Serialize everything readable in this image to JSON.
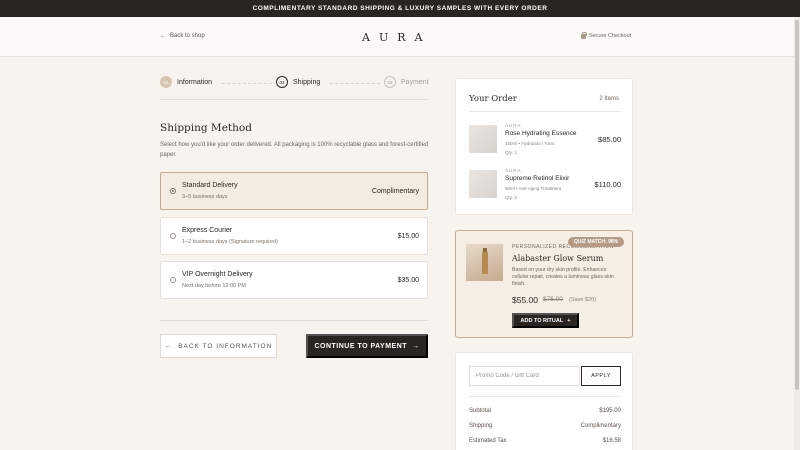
{
  "banner": {
    "text": "COMPLIMENTARY STANDARD SHIPPING & LUXURY SAMPLES WITH EVERY ORDER"
  },
  "header": {
    "back_label": "Back to shop",
    "logo": "AURA",
    "secure_label": "Secure Checkout"
  },
  "steps": [
    {
      "num": "01",
      "label": "Information"
    },
    {
      "num": "02",
      "label": "Shipping"
    },
    {
      "num": "03",
      "label": "Payment"
    }
  ],
  "shipping": {
    "title": "Shipping Method",
    "description": "Select how you'd like your order delivered. All packaging is 100% recyclable glass and forest-certified paper.",
    "options": [
      {
        "name": "Standard Delivery",
        "sub": "3–5 business days",
        "price": "Complimentary",
        "selected": true
      },
      {
        "name": "Express Courier",
        "sub": "1–2 business days (Signature required)",
        "price": "$15.00",
        "selected": false
      },
      {
        "name": "VIP Overnight Delivery",
        "sub": "Next day before 12:00 PM",
        "price": "$35.00",
        "selected": false
      }
    ]
  },
  "actions": {
    "back_label": "BACK TO INFORMATION",
    "continue_label": "CONTINUE TO PAYMENT"
  },
  "order": {
    "title": "Your Order",
    "count": "2 Items",
    "items": [
      {
        "brand": "AURA",
        "name": "Rose Hydrating Essence",
        "meta": "150ml • Hydration / Tonic",
        "qty": "Qty: 1",
        "price": "$85.00"
      },
      {
        "brand": "AURA",
        "name": "Supreme Retinol Elixir",
        "meta": "50ml • Anti-Aging Treatment",
        "qty": "Qty: 1",
        "price": "$110.00"
      }
    ]
  },
  "recommendation": {
    "badge": "QUIZ MATCH: 98%",
    "label": "PERSONALIZED RECOMMENDATION",
    "name": "Alabaster Glow Serum",
    "description": "Based on your dry skin profile. Enhances cellular repair, creates a luminous glass-skin finish.",
    "price": "$55.00",
    "old_price": "$75.00",
    "save": "(Save $20)",
    "button_label": "ADD TO RITUAL",
    "button_icon": "plus-icon"
  },
  "summary": {
    "promo_placeholder": "Promo Code / Gift Card",
    "promo_value": "",
    "apply_label": "APPLY",
    "rows": [
      {
        "label": "Subtotal",
        "value": "$195.00"
      },
      {
        "label": "Shipping",
        "value": "Complimentary"
      },
      {
        "label": "Estimated Tax",
        "value": "$16.58"
      }
    ]
  },
  "colors": {
    "dark": "#2b2522",
    "accent": "#c8a98a",
    "background": "#f7f4ef",
    "selected_bg": "#f3ece3"
  }
}
